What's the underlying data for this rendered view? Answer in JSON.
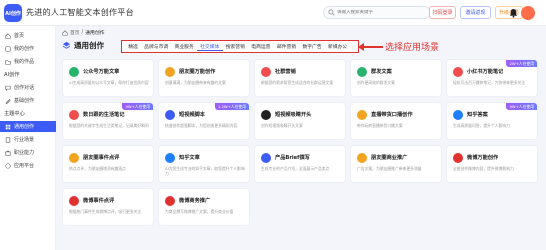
{
  "header": {
    "logo_text": "AI创作",
    "brand": "先进的人工智能文本创作平台",
    "search_placeholder": "请输入搜索关键字",
    "btn_login": "扫码登录",
    "btn_invite": "邀请返现",
    "btn_vip": "升级会员"
  },
  "sidebar": {
    "items": [
      {
        "label": "首页"
      },
      {
        "label": "我的创作"
      },
      {
        "label": "我的作品"
      },
      {
        "label": "AI创作"
      },
      {
        "label": "创作对话"
      },
      {
        "label": "基础创作"
      },
      {
        "label": "主题中心"
      },
      {
        "label": "通用创作"
      },
      {
        "label": "行业场景"
      },
      {
        "label": "职业能力"
      },
      {
        "label": "应用平台"
      }
    ]
  },
  "breadcrumb": {
    "home": "首页",
    "sep": "/",
    "current": "通用创作"
  },
  "page": {
    "title": "通用创作"
  },
  "tabs": [
    "精选",
    "品牌与市调",
    "商业服务",
    "社交媒体",
    "搜索营销",
    "电商运营",
    "邮件营销",
    "数字广告",
    "新媒办公"
  ],
  "annotation": "选择应用场景",
  "colors": {
    "accent": "#3d5cf5",
    "annotation": "#e0322e"
  },
  "cards": [
    {
      "name": "公众号万能文章",
      "desc": "AI生成高质量的公众号文章，帮你打造优质内容",
      "icon": "wechat-icon",
      "color": "#26b36a",
      "tag": ""
    },
    {
      "name": "朋友圈万能创作",
      "desc": "创意满满，为朋友圈带来有趣的文案",
      "icon": "moments-icon",
      "color": "#f2a320",
      "tag": ""
    },
    {
      "name": "社群营销",
      "desc": "根据您的需求帮您生成适合的社群运营文案",
      "icon": "community-icon",
      "color": "#f04d4d",
      "tag": ""
    },
    {
      "name": "群发文案",
      "desc": "创作更高效的群发文案",
      "icon": "broadcast-icon",
      "color": "#2ab36e",
      "tag": ""
    },
    {
      "name": "小红书万能笔记",
      "desc": "轻松写出百万爆款笔记，为你带来更多关注",
      "icon": "xiaohongshu-icon",
      "color": "#f04d4d",
      "tag": "2W+人在使用"
    },
    {
      "name": "数日跟的生活笔记",
      "desc": "根据您的关键字生成生活类笔记，记录美好瞬间",
      "icon": "note-icon",
      "color": "#f04d4d",
      "tag": "9W+人在使用"
    },
    {
      "name": "短视频脚本",
      "desc": "快速创作超强脚本，为您创造更多精彩内容",
      "icon": "video-script-icon",
      "color": "#3d5cf5",
      "tag": "1.2W+人在使用"
    },
    {
      "name": "短视频吸睛开头",
      "desc": "创作短视频吸睛开头文案",
      "icon": "tiktok-icon",
      "color": "#222222",
      "tag": ""
    },
    {
      "name": "直播带货口播创作",
      "desc": "带你玩转直播带货口播文案",
      "icon": "live-icon",
      "color": "#f2a320",
      "tag": ""
    },
    {
      "name": "知乎答案",
      "desc": "生成高质量问答，提升个人影响力",
      "icon": "zhihu-icon",
      "color": "#1e80ff",
      "tag": "9W+人在使用"
    },
    {
      "name": "朋友圈事件点评",
      "desc": "热点点评，为朋友圈增添有趣观点",
      "icon": "comment-icon",
      "color": "#f2a320",
      "tag": ""
    },
    {
      "name": "知乎文章",
      "desc": "AI为您生成专业的知乎文章，助您提升个人影响力",
      "icon": "zhihu-article-icon",
      "color": "#1e80ff",
      "tag": ""
    },
    {
      "name": "产品Brief撰写",
      "desc": "生成专业的产品介绍，全面展示产品卖点",
      "icon": "brief-icon",
      "color": "#3d5cf5",
      "tag": ""
    },
    {
      "name": "朋友圈商业推广",
      "desc": "广告文案，为朋友圈推广带来更多流量",
      "icon": "promo-icon",
      "color": "#f2a320",
      "tag": ""
    },
    {
      "name": "微博万能创作",
      "desc": "全能创作微博内容，提升微博影响力",
      "icon": "weibo-icon",
      "color": "#e0322e",
      "tag": ""
    },
    {
      "name": "微博事件点评",
      "desc": "根据热门事件生成微博点评，吸引更多关注",
      "icon": "weibo-comment-icon",
      "color": "#e0322e",
      "tag": ""
    },
    {
      "name": "微博商务推广",
      "desc": "为商品撰写微博推广文案，提升商业价值",
      "icon": "weibo-promo-icon",
      "color": "#e0322e",
      "tag": ""
    }
  ]
}
